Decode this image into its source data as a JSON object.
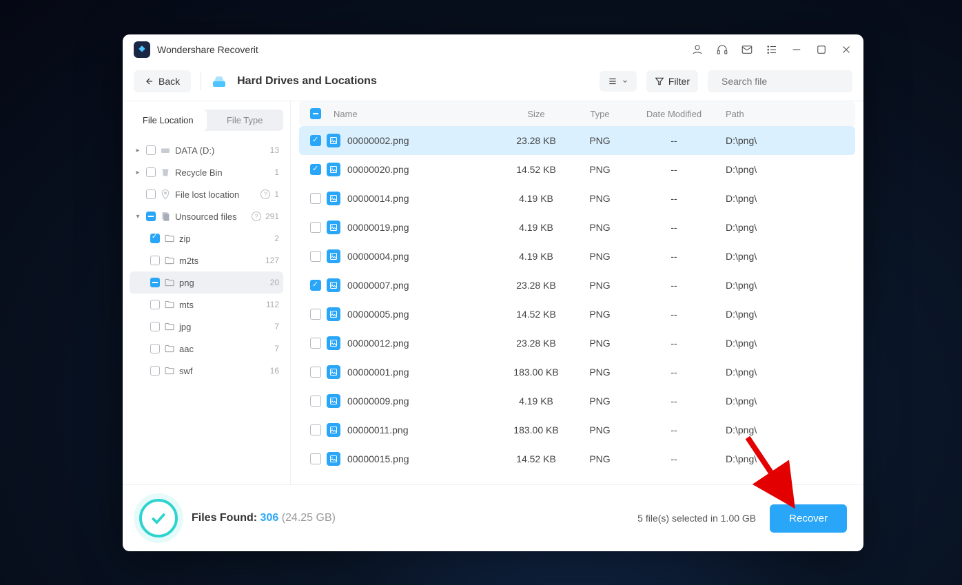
{
  "app": {
    "title": "Wondershare Recoverit"
  },
  "toolbar": {
    "back": "Back",
    "page_title": "Hard Drives and Locations",
    "filter": "Filter",
    "search_placeholder": "Search file"
  },
  "sidebar": {
    "tab_location": "File Location",
    "tab_type": "File Type",
    "tree": [
      {
        "label": "DATA (D:)",
        "count": "13",
        "icon": "drive",
        "checked": false,
        "partial": false,
        "nested": 0,
        "arrow": "▸"
      },
      {
        "label": "Recycle Bin",
        "count": "1",
        "icon": "trash",
        "checked": false,
        "partial": false,
        "nested": 0,
        "arrow": "▸"
      },
      {
        "label": "File lost location",
        "count": "1",
        "icon": "location",
        "checked": false,
        "partial": false,
        "nested": 1,
        "help": true
      },
      {
        "label": "Unsourced files",
        "count": "291",
        "icon": "docs",
        "checked": false,
        "partial": true,
        "nested": 0,
        "arrow": "▾",
        "help": true
      },
      {
        "label": "zip",
        "count": "2",
        "icon": "folder",
        "checked": true,
        "partial": false,
        "nested": 2
      },
      {
        "label": "m2ts",
        "count": "127",
        "icon": "folder",
        "checked": false,
        "partial": false,
        "nested": 2
      },
      {
        "label": "png",
        "count": "20",
        "icon": "folder",
        "checked": false,
        "partial": true,
        "nested": 2,
        "active": true
      },
      {
        "label": "mts",
        "count": "112",
        "icon": "folder",
        "checked": false,
        "partial": false,
        "nested": 2
      },
      {
        "label": "jpg",
        "count": "7",
        "icon": "folder",
        "checked": false,
        "partial": false,
        "nested": 2
      },
      {
        "label": "aac",
        "count": "7",
        "icon": "folder",
        "checked": false,
        "partial": false,
        "nested": 2
      },
      {
        "label": "swf",
        "count": "16",
        "icon": "folder",
        "checked": false,
        "partial": false,
        "nested": 2
      }
    ]
  },
  "table": {
    "headers": {
      "name": "Name",
      "size": "Size",
      "type": "Type",
      "date": "Date Modified",
      "path": "Path"
    },
    "rows": [
      {
        "name": "00000002.png",
        "size": "23.28 KB",
        "type": "PNG",
        "date": "--",
        "path": "D:\\png\\",
        "checked": true,
        "selected": true
      },
      {
        "name": "00000020.png",
        "size": "14.52 KB",
        "type": "PNG",
        "date": "--",
        "path": "D:\\png\\",
        "checked": true
      },
      {
        "name": "00000014.png",
        "size": "4.19 KB",
        "type": "PNG",
        "date": "--",
        "path": "D:\\png\\",
        "checked": false
      },
      {
        "name": "00000019.png",
        "size": "4.19 KB",
        "type": "PNG",
        "date": "--",
        "path": "D:\\png\\",
        "checked": false
      },
      {
        "name": "00000004.png",
        "size": "4.19 KB",
        "type": "PNG",
        "date": "--",
        "path": "D:\\png\\",
        "checked": false
      },
      {
        "name": "00000007.png",
        "size": "23.28 KB",
        "type": "PNG",
        "date": "--",
        "path": "D:\\png\\",
        "checked": true
      },
      {
        "name": "00000005.png",
        "size": "14.52 KB",
        "type": "PNG",
        "date": "--",
        "path": "D:\\png\\",
        "checked": false
      },
      {
        "name": "00000012.png",
        "size": "23.28 KB",
        "type": "PNG",
        "date": "--",
        "path": "D:\\png\\",
        "checked": false
      },
      {
        "name": "00000001.png",
        "size": "183.00 KB",
        "type": "PNG",
        "date": "--",
        "path": "D:\\png\\",
        "checked": false
      },
      {
        "name": "00000009.png",
        "size": "4.19 KB",
        "type": "PNG",
        "date": "--",
        "path": "D:\\png\\",
        "checked": false
      },
      {
        "name": "00000011.png",
        "size": "183.00 KB",
        "type": "PNG",
        "date": "--",
        "path": "D:\\png\\",
        "checked": false
      },
      {
        "name": "00000015.png",
        "size": "14.52 KB",
        "type": "PNG",
        "date": "--",
        "path": "D:\\png\\",
        "checked": false
      }
    ]
  },
  "footer": {
    "found_label": "Files Found: ",
    "found_count": "306",
    "found_size": "(24.25 GB)",
    "selected_text": "5 file(s) selected in 1.00 GB",
    "recover": "Recover"
  }
}
